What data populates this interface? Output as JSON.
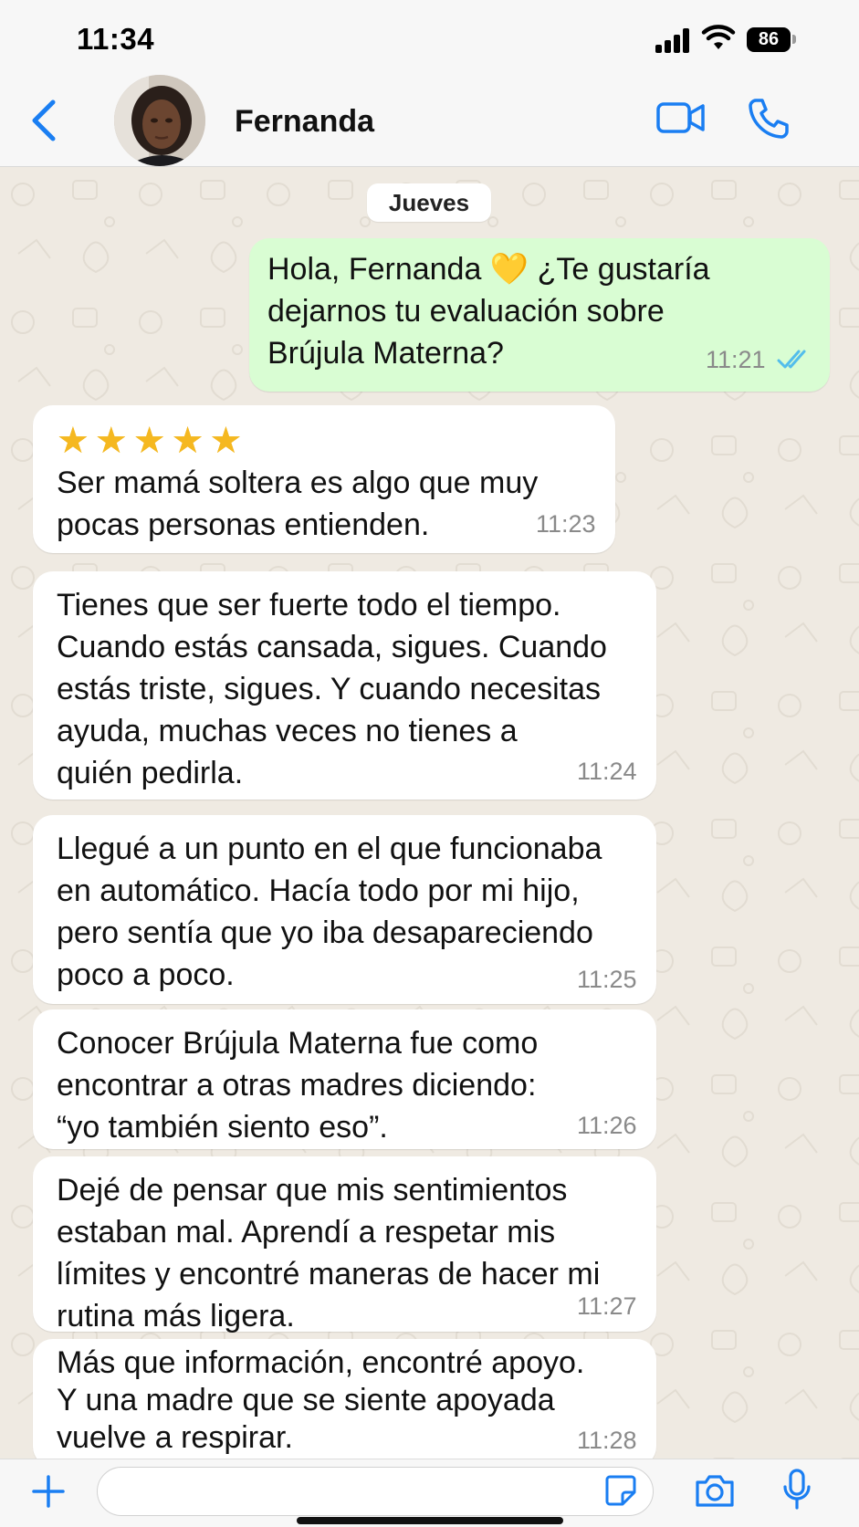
{
  "status_bar": {
    "time": "11:34",
    "battery": "86"
  },
  "header": {
    "contact_name": "Fernanda"
  },
  "chat": {
    "date_label": "Jueves",
    "outgoing": {
      "text": "Hola, Fernanda 💛 ¿Te gustaría\ndejarnos tu evaluación sobre\nBrújula Materna?",
      "time": "11:21"
    },
    "incoming": [
      {
        "stars": "★★★★★",
        "text": "Ser mamá soltera es algo que muy\npocas personas entienden.",
        "time": "11:23"
      },
      {
        "text": "Tienes que ser fuerte todo el tiempo.\nCuando estás cansada, sigues. Cuando\nestás triste, sigues. Y cuando necesitas\nayuda, muchas veces no tienes a\nquién pedirla.",
        "time": "11:24"
      },
      {
        "text": "Llegué a un punto en el que funcionaba\nen automático. Hacía todo por mi hijo,\npero sentía que yo iba desapareciendo\npoco a poco.",
        "time": "11:25"
      },
      {
        "text": "Conocer Brújula Materna fue como\nencontrar a otras madres diciendo:\n“yo también siento eso”.",
        "time": "11:26"
      },
      {
        "text": "Dejé de pensar que mis sentimientos\nestaban mal. Aprendí a respetar mis\nlímites y encontré maneras de hacer mi\nrutina más ligera.",
        "time": "11:27"
      },
      {
        "text": "Más que información, encontré apoyo.\nY una madre que se siente apoyada\nvuelve a respirar.",
        "time": "11:28"
      }
    ]
  },
  "colors": {
    "accent": "#1a7ef2",
    "outgoing_bubble": "#d9fdd3",
    "incoming_bubble": "#ffffff",
    "chat_background": "#efeae2",
    "read_ticks": "#53bdeb"
  },
  "icons": [
    "back-chevron-icon",
    "video-call-icon",
    "phone-icon",
    "plus-icon",
    "sticker-icon",
    "camera-icon",
    "microphone-icon",
    "signal-icon",
    "wifi-icon",
    "battery-icon",
    "read-ticks-icon"
  ]
}
